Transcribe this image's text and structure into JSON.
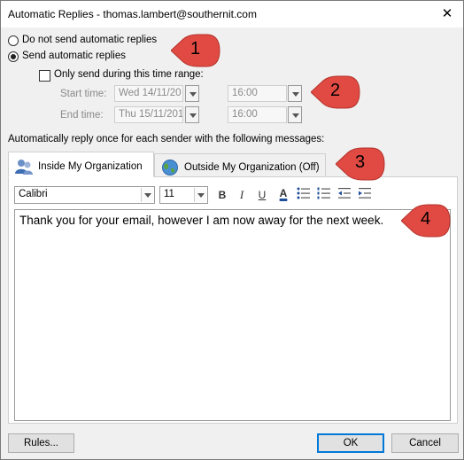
{
  "window": {
    "title": "Automatic Replies - thomas.lambert@southernit.com",
    "close_glyph": "✕"
  },
  "options": {
    "do_not_send_label": "Do not send automatic replies",
    "send_label": "Send automatic replies",
    "time_range_label": "Only send during this time range:",
    "start_time_label": "Start time:",
    "start_date": "Wed 14/11/20",
    "start_hour": "16:00",
    "end_time_label": "End time:",
    "end_date": "Thu 15/11/201",
    "end_hour": "16:00"
  },
  "messages": {
    "heading": "Automatically reply once for each sender with the following messages:",
    "tabs": [
      {
        "label": "Inside My Organization",
        "icon": "people-icon",
        "active": true
      },
      {
        "label": "Outside My Organization (Off)",
        "icon": "globe-icon",
        "active": false
      }
    ]
  },
  "toolbar": {
    "font": "Calibri",
    "size": "11",
    "bold": "B",
    "italic": "I",
    "underline": "U",
    "font_color": "A"
  },
  "editor": {
    "text": "Thank you for your email, however I am now away for the next week."
  },
  "footer": {
    "rules_label": "Rules...",
    "ok_label": "OK",
    "cancel_label": "Cancel"
  },
  "callouts": [
    "1",
    "2",
    "3",
    "4"
  ],
  "colors": {
    "callout": "#e04a43",
    "accent": "#0078d7"
  }
}
